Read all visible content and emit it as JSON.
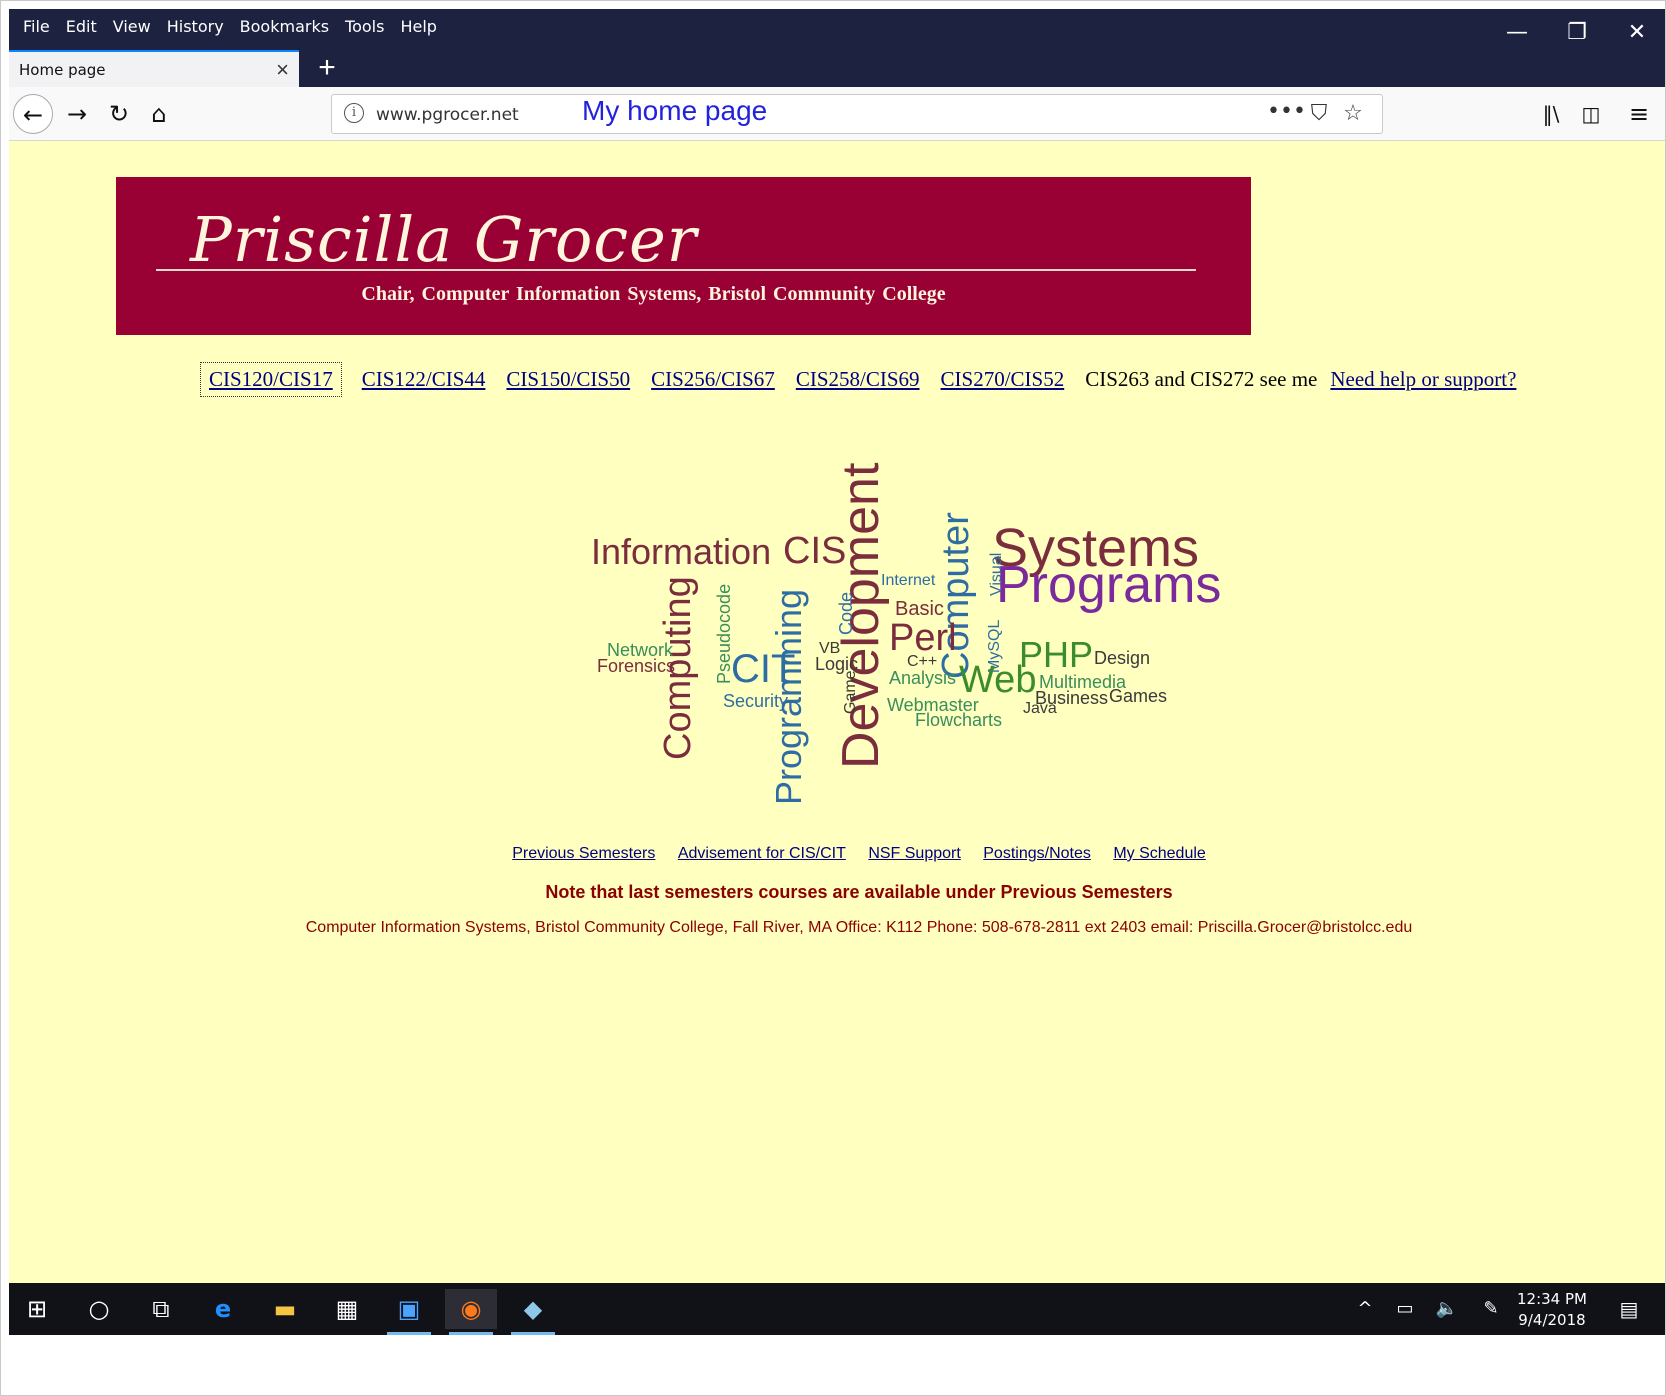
{
  "browser": {
    "menu": [
      "File",
      "Edit",
      "View",
      "History",
      "Bookmarks",
      "Tools",
      "Help"
    ],
    "tab_title": "Home page",
    "url": "www.pgrocer.net",
    "url_caption": "My home page",
    "icons": {
      "minimize": "minimize-icon",
      "restore": "restore-icon",
      "close": "close-icon",
      "back": "back-arrow-icon",
      "forward": "forward-arrow-icon",
      "reload": "reload-icon",
      "home": "home-icon",
      "info": "info-icon",
      "page_actions": "ellipsis-icon",
      "pocket": "pocket-icon",
      "bookmark": "star-icon",
      "library": "library-icon",
      "sidebar": "sidebar-icon",
      "menu": "hamburger-menu-icon"
    }
  },
  "page": {
    "background": "#ffffc0",
    "banner": {
      "name": "Priscilla Grocer",
      "subtitle": "Chair,  Computer Information Systems,  Bristol Community College",
      "color": "#990033"
    },
    "course_links": [
      {
        "label": "CIS120/CIS17",
        "type": "link"
      },
      {
        "label": "CIS122/CIS44",
        "type": "link"
      },
      {
        "label": "CIS150/CIS50",
        "type": "link"
      },
      {
        "label": "CIS256/CIS67",
        "type": "link"
      },
      {
        "label": "CIS258/CIS69",
        "type": "link"
      },
      {
        "label": "CIS270/CIS52",
        "type": "link"
      },
      {
        "label": "CIS263 and CIS272 see me",
        "type": "text"
      },
      {
        "label": "Need help or support?",
        "type": "link"
      }
    ],
    "word_cloud": [
      "Information",
      "CIS",
      "Internet",
      "Systems",
      "Development",
      "Computer",
      "Programs",
      "Computing",
      "Pseudocode",
      "Programming",
      "Code",
      "Basic",
      "Perl",
      "Visual",
      "MySQL",
      "PHP",
      "Design",
      "Network",
      "Forensics",
      "CIT",
      "VB",
      "Logic",
      "C++",
      "Analysis",
      "Web",
      "Multimedia",
      "Security",
      "Game",
      "Webmaster",
      "Business",
      "Games",
      "Java",
      "Flowcharts"
    ],
    "footer_links": [
      "Previous Semesters",
      "Advisement for CIS/CIT",
      "NSF Support",
      "Postings/Notes",
      "My Schedule"
    ],
    "note": "Note that last semesters courses are available under Previous Semesters",
    "contact": "Computer Information Systems, Bristol Community College, Fall River, MA Office: K112 Phone: 508-678-2811 ext 2403 email: Priscilla.Grocer@bristolcc.edu"
  },
  "taskbar": {
    "icons": [
      "windows-start-icon",
      "search-circle-icon",
      "task-view-icon",
      "edge-icon",
      "file-explorer-icon",
      "store-icon",
      "notepad-icon",
      "firefox-icon",
      "app-icon"
    ],
    "tray_icons": [
      "chevron-up-icon",
      "network-icon",
      "volume-icon",
      "pen-icon",
      "notifications-icon"
    ],
    "time": "12:34 PM",
    "date": "9/4/2018"
  }
}
